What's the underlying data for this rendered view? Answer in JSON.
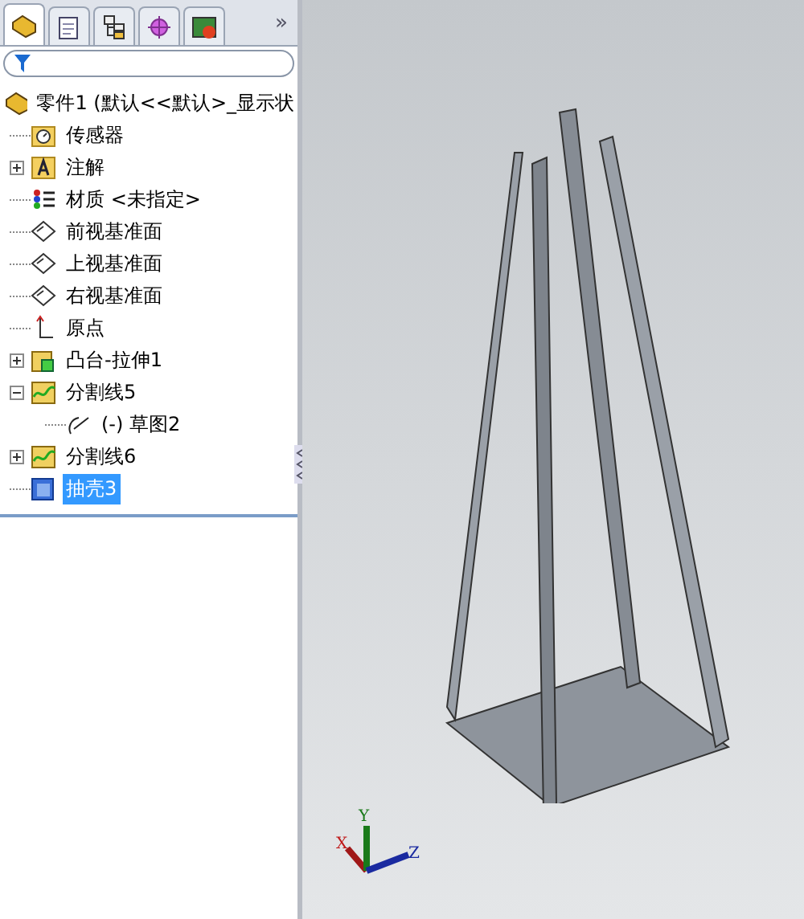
{
  "tabs": [
    {
      "kind": "features",
      "selected": true
    },
    {
      "kind": "properties",
      "selected": false
    },
    {
      "kind": "config",
      "selected": false
    },
    {
      "kind": "dimxpert",
      "selected": false
    },
    {
      "kind": "display",
      "selected": false
    }
  ],
  "tab_overflow": "»",
  "tree": {
    "root": "零件1  (默认<<默认>_显示状",
    "items": [
      {
        "kind": "sensor",
        "label": "传感器",
        "selected": false
      },
      {
        "kind": "annotation",
        "label": "注解",
        "expanded": false,
        "selected": false
      },
      {
        "kind": "material",
        "label": "材质 <未指定>",
        "selected": false
      },
      {
        "kind": "plane",
        "label": "前视基准面",
        "selected": false
      },
      {
        "kind": "plane",
        "label": "上视基准面",
        "selected": false
      },
      {
        "kind": "plane",
        "label": "右视基准面",
        "selected": false
      },
      {
        "kind": "origin",
        "label": "原点",
        "selected": false
      },
      {
        "kind": "extrude",
        "label": "凸台-拉伸1",
        "expanded": false,
        "selected": false
      },
      {
        "kind": "split",
        "label": "分割线5",
        "expanded": true,
        "selected": false,
        "children": [
          {
            "kind": "sketch",
            "label": "(-) 草图2",
            "selected": false
          }
        ]
      },
      {
        "kind": "split",
        "label": "分割线6",
        "expanded": false,
        "selected": false
      },
      {
        "kind": "shell",
        "label": "抽壳3",
        "selected": true
      }
    ]
  },
  "triad": {
    "x": "X",
    "y": "Y",
    "z": "Z"
  }
}
